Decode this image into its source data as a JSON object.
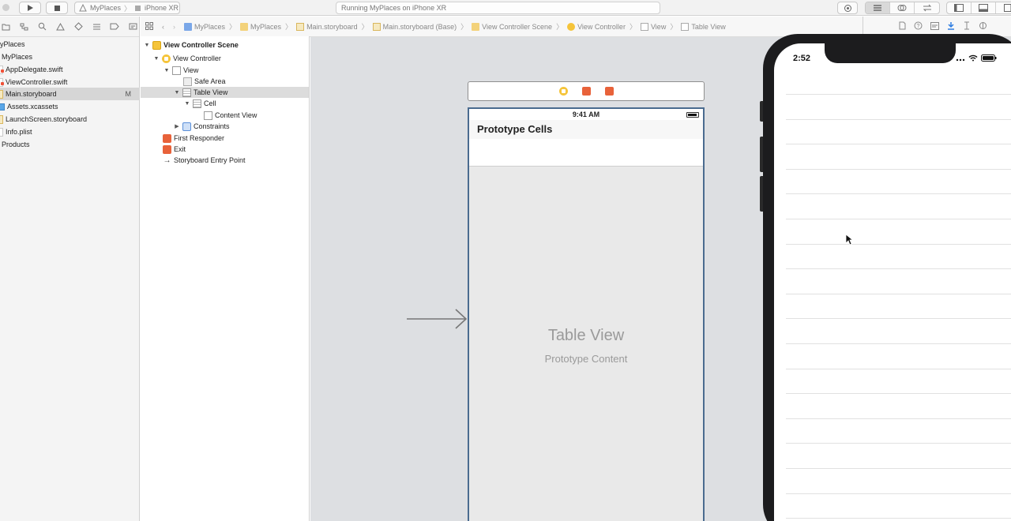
{
  "toolbar": {
    "scheme_project": "MyPlaces",
    "scheme_device": "iPhone XR",
    "activity_text": "Running MyPlaces on iPhone XR"
  },
  "navigator": {
    "items": [
      {
        "label": "yPlaces",
        "type": "project"
      },
      {
        "label": "MyPlaces",
        "type": "folder"
      },
      {
        "label": "AppDelegate.swift",
        "type": "swift"
      },
      {
        "label": "ViewController.swift",
        "type": "swift"
      },
      {
        "label": "Main.storyboard",
        "type": "storyboard",
        "badge": "M",
        "selected": true
      },
      {
        "label": "Assets.xcassets",
        "type": "assets"
      },
      {
        "label": "LaunchScreen.storyboard",
        "type": "storyboard"
      },
      {
        "label": "Info.plist",
        "type": "plist"
      },
      {
        "label": "Products",
        "type": "folder"
      }
    ]
  },
  "jumpbar": {
    "crumbs": [
      "MyPlaces",
      "MyPlaces",
      "Main.storyboard",
      "Main.storyboard (Base)",
      "View Controller Scene",
      "View Controller",
      "View",
      "Table View"
    ]
  },
  "outline": {
    "items": [
      {
        "label": "View Controller Scene"
      },
      {
        "label": "View Controller"
      },
      {
        "label": "View"
      },
      {
        "label": "Safe Area"
      },
      {
        "label": "Table View"
      },
      {
        "label": "Cell"
      },
      {
        "label": "Content View"
      },
      {
        "label": "Constraints"
      },
      {
        "label": "First Responder"
      },
      {
        "label": "Exit"
      },
      {
        "label": "Storyboard Entry Point"
      }
    ]
  },
  "canvas": {
    "status_time": "9:41 AM",
    "prototype_header": "Prototype Cells",
    "table_title": "Table View",
    "table_subtitle": "Prototype Content"
  },
  "simulator": {
    "time": "2:52"
  }
}
